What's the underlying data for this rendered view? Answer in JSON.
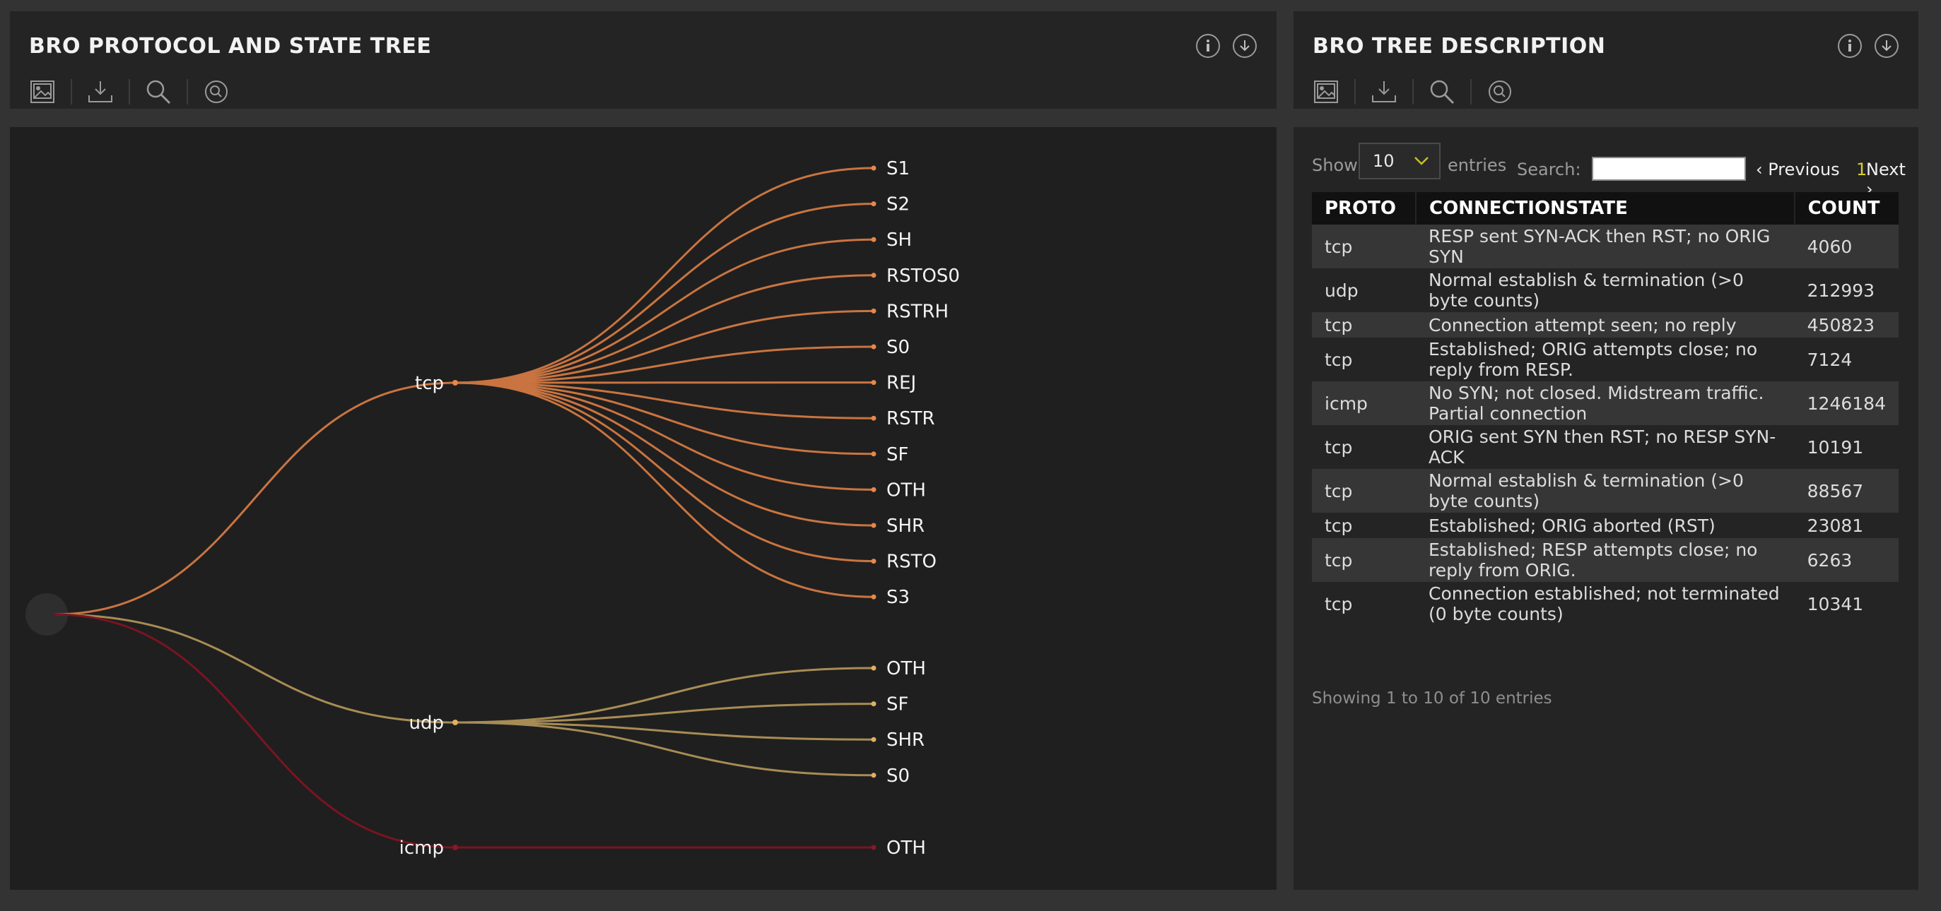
{
  "left_panel": {
    "title": "BRO PROTOCOL AND STATE TREE",
    "info_icon": "info-icon",
    "download_icon": "download-icon",
    "tools": [
      "image-export-icon",
      "download-tray-icon",
      "search-icon",
      "zoom-reset-icon"
    ]
  },
  "right_panel": {
    "title": "BRO TREE DESCRIPTION",
    "info_icon": "info-icon",
    "download_icon": "download-icon",
    "tools": [
      "image-export-icon",
      "download-tray-icon",
      "search-icon",
      "zoom-reset-icon"
    ]
  },
  "tree": {
    "root": {
      "color": "#2e2e2e"
    },
    "protocols": [
      {
        "name": "tcp",
        "color": "#e8874a",
        "link_color": "#c97440",
        "states": [
          "S1",
          "S2",
          "SH",
          "RSTOS0",
          "RSTRH",
          "S0",
          "REJ",
          "RSTR",
          "SF",
          "OTH",
          "SHR",
          "RSTO",
          "S3"
        ]
      },
      {
        "name": "udp",
        "color": "#e0b060",
        "link_color": "#a88c55",
        "states": [
          "OTH",
          "SF",
          "SHR",
          "S0"
        ]
      },
      {
        "name": "icmp",
        "color": "#8a1826",
        "link_color": "#7a1422",
        "states": [
          "OTH"
        ]
      }
    ]
  },
  "table": {
    "show_label": "Show",
    "entries_value": "10",
    "entries_label": "entries",
    "search_label": "Search:",
    "search_value": "",
    "prev_label": "Previous",
    "page_number": "1",
    "next_label": "Next",
    "columns": [
      "PROTO",
      "CONNECTIONSTATE",
      "COUNT"
    ],
    "rows": [
      {
        "proto": "tcp",
        "state": "RESP sent SYN-ACK then RST; no ORIG SYN",
        "count": "4060"
      },
      {
        "proto": "udp",
        "state": "Normal establish & termination (>0 byte counts)",
        "count": "212993"
      },
      {
        "proto": "tcp",
        "state": "Connection attempt seen; no reply",
        "count": "450823"
      },
      {
        "proto": "tcp",
        "state": "Established; ORIG attempts close; no reply from RESP.",
        "count": "7124"
      },
      {
        "proto": "icmp",
        "state": "No SYN; not closed. Midstream traffic. Partial connection",
        "count": "1246184"
      },
      {
        "proto": "tcp",
        "state": "ORIG sent SYN then RST; no RESP SYN-ACK",
        "count": "10191"
      },
      {
        "proto": "tcp",
        "state": "Normal establish & termination (>0 byte counts)",
        "count": "88567"
      },
      {
        "proto": "tcp",
        "state": "Established; ORIG aborted (RST)",
        "count": "23081"
      },
      {
        "proto": "tcp",
        "state": "Established; RESP attempts close; no reply from ORIG.",
        "count": "6263"
      },
      {
        "proto": "tcp",
        "state": "Connection established; not terminated (0 byte counts)",
        "count": "10341"
      }
    ],
    "info": "Showing 1 to 10 of 10 entries"
  }
}
